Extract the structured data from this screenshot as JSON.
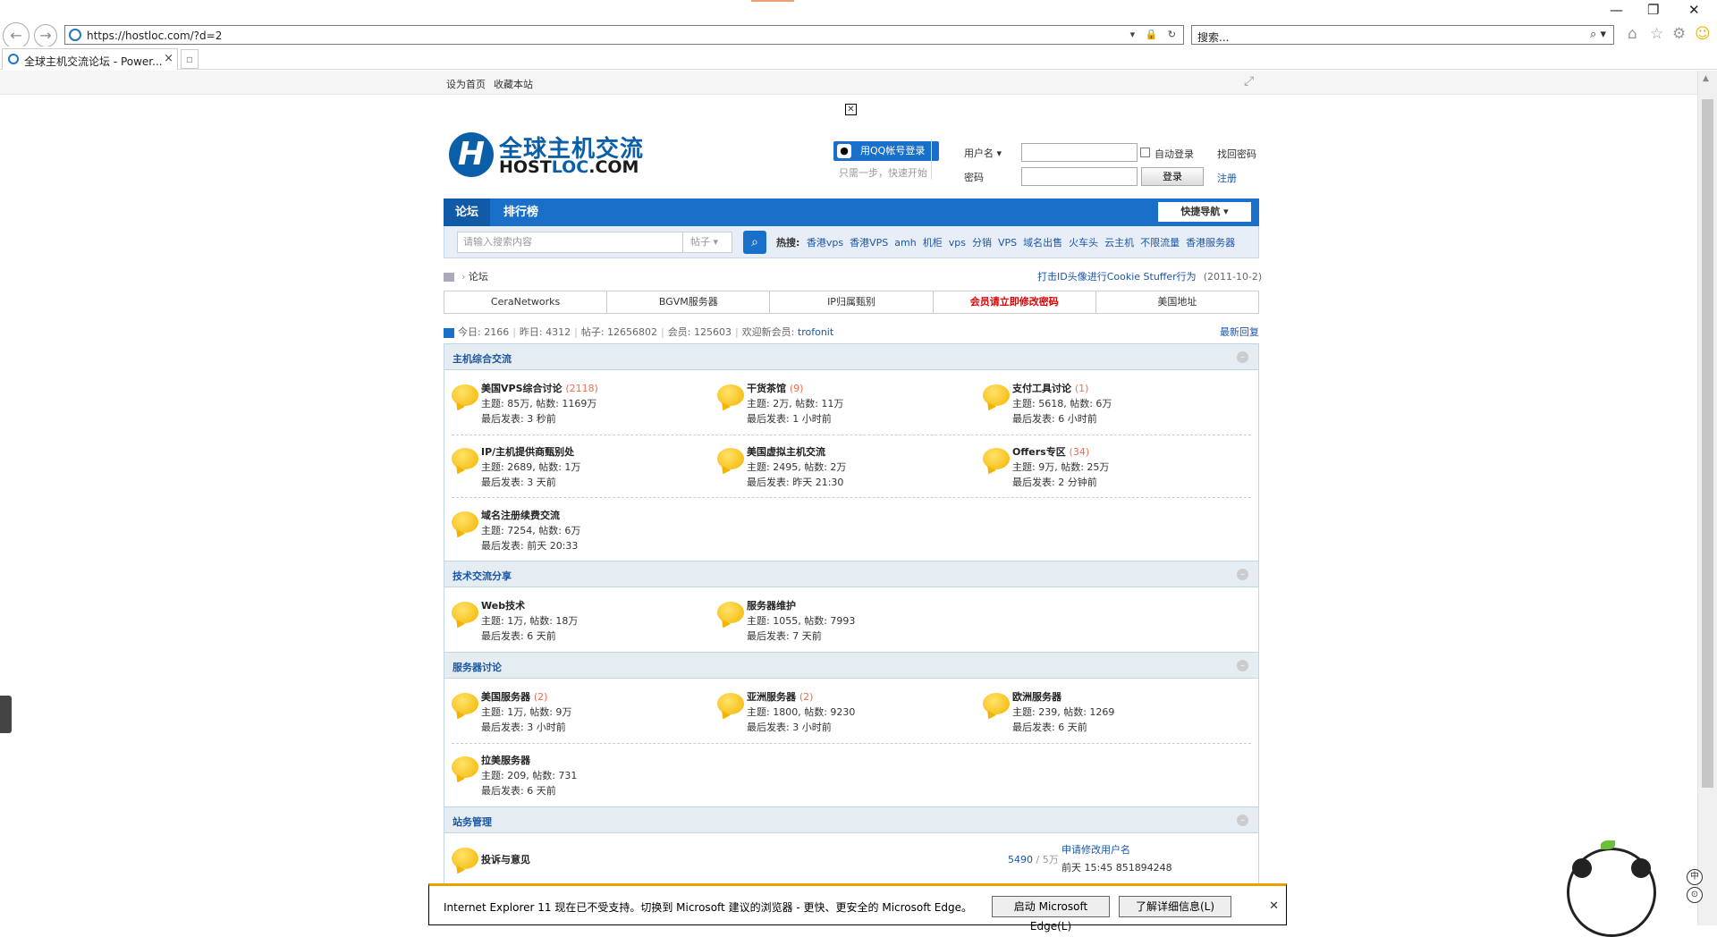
{
  "browser": {
    "url": "https://hostloc.com/?d=2",
    "search_placeholder": "搜索...",
    "tab_title": "全球主机交流论坛 - Power...",
    "tab_close": "×"
  },
  "topbar": {
    "sethome": "设为首页",
    "favorite": "收藏本站"
  },
  "logo": {
    "cn": "全球主机交流",
    "en_host": "HOST",
    "en_loc": "LOC",
    "en_com": ".COM"
  },
  "qq": {
    "label": "用QQ帐号登录",
    "sub": "只需一步，快速开始"
  },
  "login": {
    "user_label": "用户名",
    "pass_label": "密码",
    "auto_label": "自动登录",
    "forgot": "找回密码",
    "register": "注册",
    "login_btn": "登录"
  },
  "nav": {
    "forum": "论坛",
    "ranking": "排行榜",
    "quick": "快捷导航"
  },
  "search": {
    "placeholder": "请输入搜索内容",
    "type": "帖子",
    "hot_label": "热搜:",
    "hot": [
      "香港vps",
      "香港VPS",
      "amh",
      "机柜",
      "vps",
      "分销",
      "VPS",
      "域名出售",
      "火车头",
      "云主机",
      "不限流量",
      "香港服务器"
    ]
  },
  "breadcrumb": {
    "current": "论坛",
    "notice": "打击ID头像进行Cookie Stuffer行为",
    "notice_date": "(2011-10-2)"
  },
  "ads": [
    "CeraNetworks",
    "BGVM服务器",
    "IP归属甄别",
    "会员请立即修改密码",
    "美国地址"
  ],
  "stats": {
    "today": "今日: 2166",
    "yesterday": "昨日: 4312",
    "posts": "帖子: 12656802",
    "members": "会员: 125603",
    "welcome": "欢迎新会员:",
    "newmember": "trofonit",
    "latest": "最新回复"
  },
  "categories": [
    {
      "title": "主机综合交流",
      "forums": [
        {
          "name": "美国VPS综合讨论",
          "count": "(2118)",
          "stats": "主题: 85万, 帖数: 1169万",
          "last": "最后发表: 3 秒前"
        },
        {
          "name": "干货茶馆",
          "count": "(9)",
          "stats": "主题: 2万, 帖数: 11万",
          "last": "最后发表: 1 小时前"
        },
        {
          "name": "支付工具讨论",
          "count": "(1)",
          "stats": "主题: 5618, 帖数: 6万",
          "last": "最后发表: 6 小时前"
        },
        {
          "name": "IP/主机提供商甄别处",
          "count": "",
          "stats": "主题: 2689, 帖数: 1万",
          "last": "最后发表: 3 天前"
        },
        {
          "name": "美国虚拟主机交流",
          "count": "",
          "stats": "主题: 2495, 帖数: 2万",
          "last": "最后发表: 昨天 21:30"
        },
        {
          "name": "Offers专区",
          "count": "(34)",
          "stats": "主题: 9万, 帖数: 25万",
          "last": "最后发表: 2 分钟前"
        },
        {
          "name": "域名注册续费交流",
          "count": "",
          "stats": "主题: 7254, 帖数: 6万",
          "last": "最后发表: 前天 20:33"
        }
      ]
    },
    {
      "title": "技术交流分享",
      "forums": [
        {
          "name": "Web技术",
          "count": "",
          "stats": "主题: 1万, 帖数: 18万",
          "last": "最后发表: 6 天前"
        },
        {
          "name": "服务器维护",
          "count": "",
          "stats": "主题: 1055, 帖数: 7993",
          "last": "最后发表: 7 天前"
        }
      ]
    },
    {
      "title": "服务器讨论",
      "forums": [
        {
          "name": "美国服务器",
          "count": "(2)",
          "stats": "主题: 1万, 帖数: 9万",
          "last": "最后发表: 3 小时前"
        },
        {
          "name": "亚洲服务器",
          "count": "(2)",
          "stats": "主题: 1800, 帖数: 9230",
          "last": "最后发表: 3 小时前"
        },
        {
          "name": "欧洲服务器",
          "count": "",
          "stats": "主题: 239, 帖数: 1269",
          "last": "最后发表: 6 天前"
        },
        {
          "name": "拉美服务器",
          "count": "",
          "stats": "主题: 209, 帖数: 731",
          "last": "最后发表: 6 天前"
        }
      ]
    },
    {
      "title": "站务管理",
      "forums": [
        {
          "name": "投诉与意见",
          "count": "",
          "stats_a": "5490",
          "stats_b": "/ 5万",
          "last_title": "申请修改用户名",
          "last_info": "前天 15:45 851894248"
        }
      ]
    }
  ],
  "iebar": {
    "message": "Internet Explorer 11 现在已不受支持。切换到 Microsoft 建议的浏览器 - 更快、更安全的 Microsoft Edge。",
    "launch": "启动 Microsoft Edge(L)",
    "learn": "了解详细信息(L)"
  },
  "ime": {
    "a": "中",
    "b": "⊙"
  },
  "colors": {
    "brand_blue": "#1a6fc9",
    "link": "#1a56a8",
    "alert_red": "#e10000",
    "count_orange": "#f26c4f"
  }
}
